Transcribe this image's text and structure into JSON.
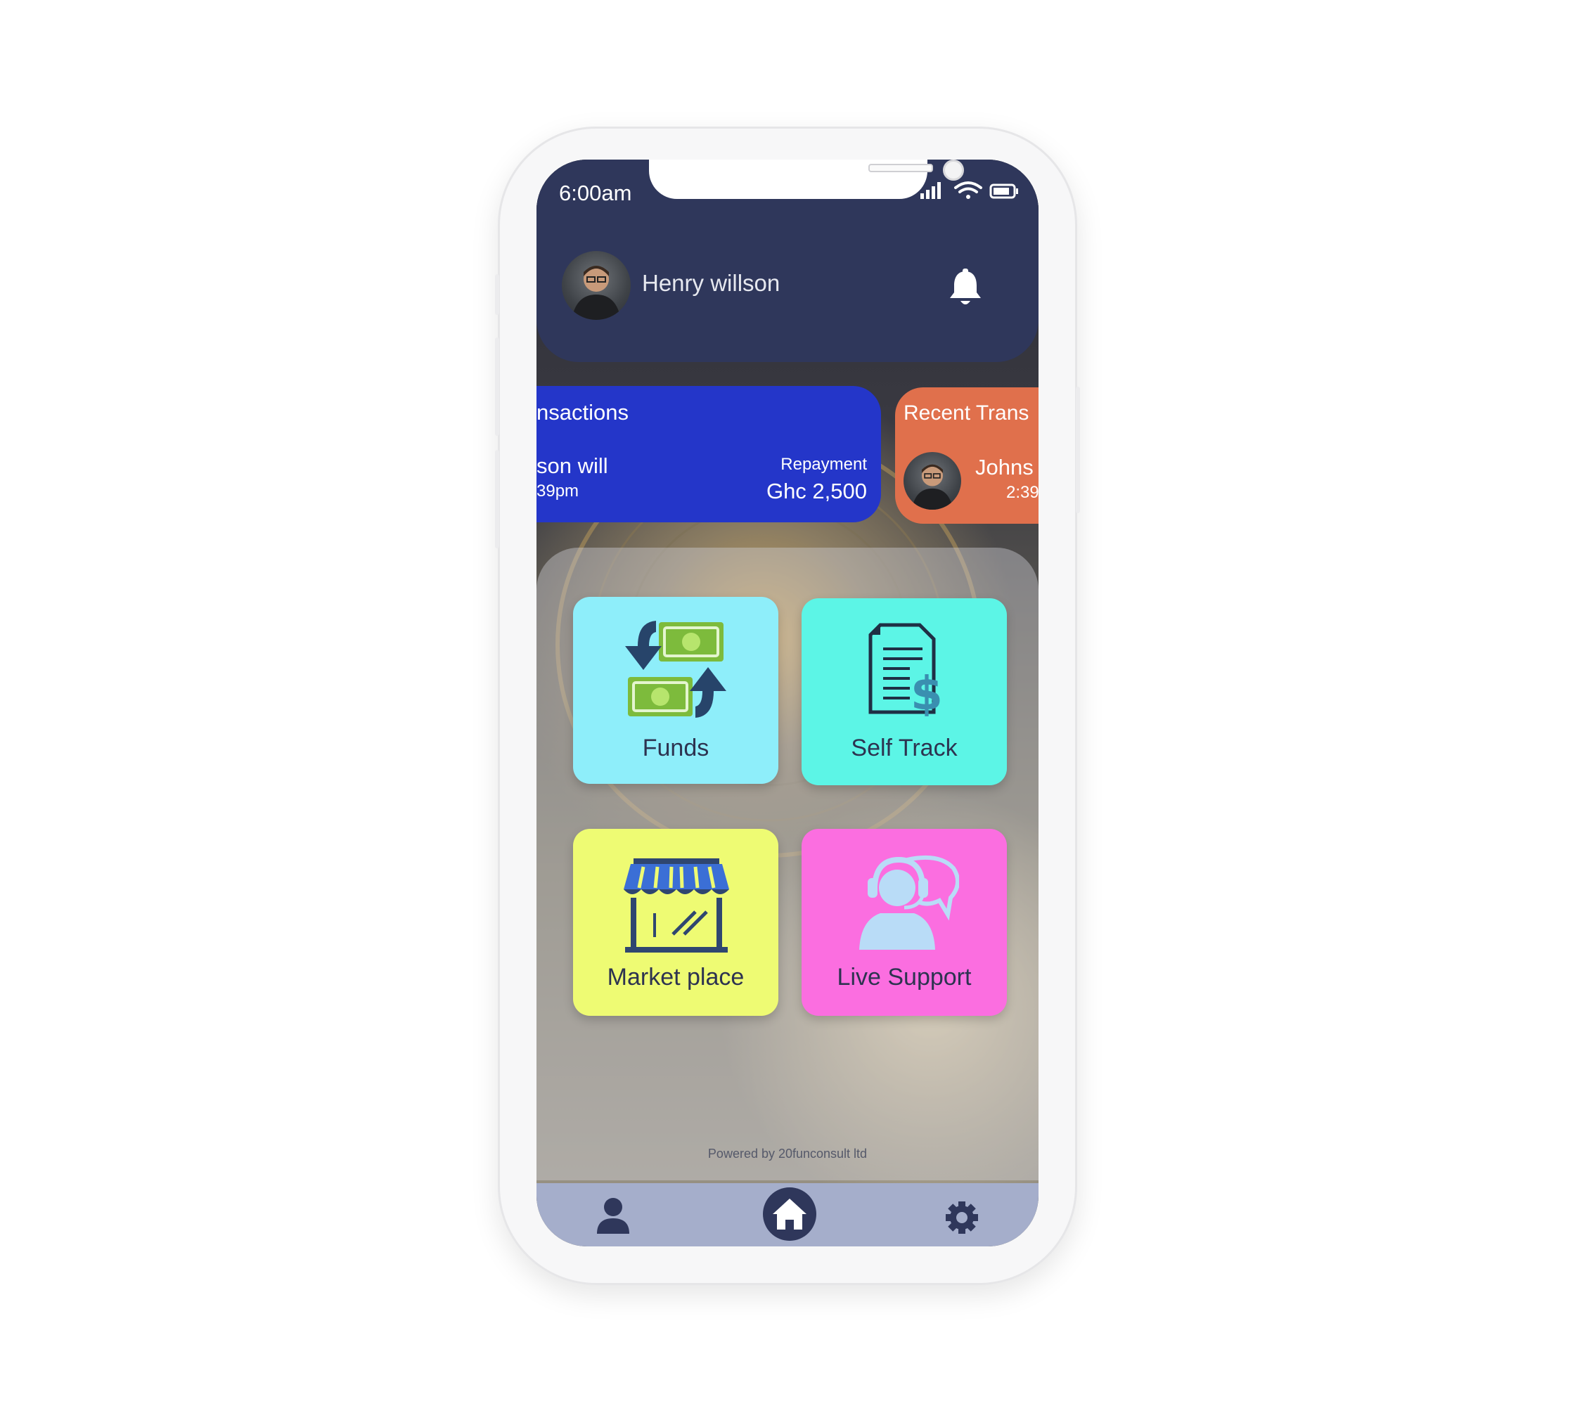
{
  "status_bar": {
    "time": "6:00am"
  },
  "header": {
    "user_name": "Henry willson"
  },
  "cards": [
    {
      "title": "nsactions",
      "name": "son will",
      "time": "39pm",
      "type": "Repayment",
      "amount": "Ghc 2,500"
    },
    {
      "title": "Recent Trans",
      "name": "Johns",
      "time": "2:39"
    }
  ],
  "tiles": [
    {
      "label": "Funds",
      "color": "#8eeefa",
      "icon": "funds-exchange-icon"
    },
    {
      "label": "Self Track",
      "color": "#5cf5e6",
      "icon": "invoice-dollar-icon"
    },
    {
      "label": "Market place",
      "color": "#eefb73",
      "icon": "storefront-icon"
    },
    {
      "label": "Live Support",
      "color": "#fb6ee0",
      "icon": "headset-agent-icon"
    }
  ],
  "footer": {
    "powered_by": "Powered by 20funconsult ltd"
  },
  "nav": {
    "items": [
      "profile-icon",
      "home-icon",
      "settings-icon"
    ]
  },
  "colors": {
    "header": "#2f375b",
    "card_blue": "#2436c9",
    "card_orange": "#e0704c",
    "navbar": "#a5aecb"
  }
}
